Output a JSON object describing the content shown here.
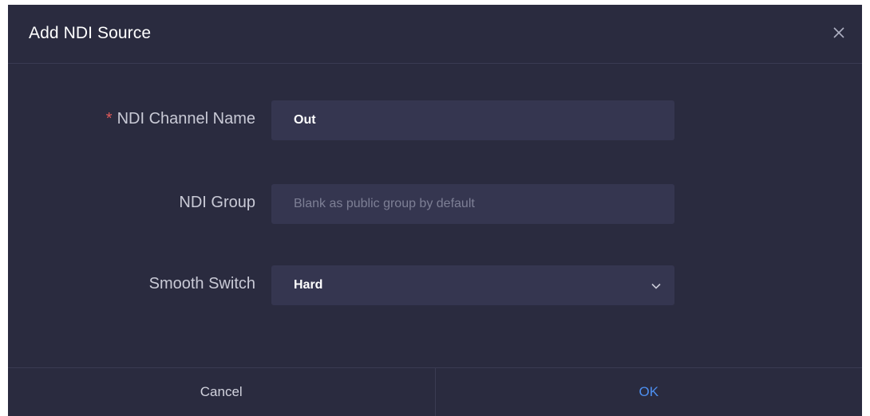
{
  "dialog": {
    "title": "Add NDI Source",
    "close_icon": "close-icon"
  },
  "form": {
    "channel_name": {
      "required_mark": "*",
      "label": "NDI Channel Name",
      "value": "Out"
    },
    "group": {
      "label": "NDI Group",
      "value": "",
      "placeholder": "Blank as public group by default"
    },
    "smooth_switch": {
      "label": "Smooth Switch",
      "selected": "Hard",
      "icon": "chevron-down-icon"
    }
  },
  "footer": {
    "cancel_label": "Cancel",
    "ok_label": "OK"
  },
  "colors": {
    "dialog_bg": "#2a2b3f",
    "field_bg": "#353650",
    "required": "#e05a5a",
    "accent": "#4d8ff0"
  }
}
